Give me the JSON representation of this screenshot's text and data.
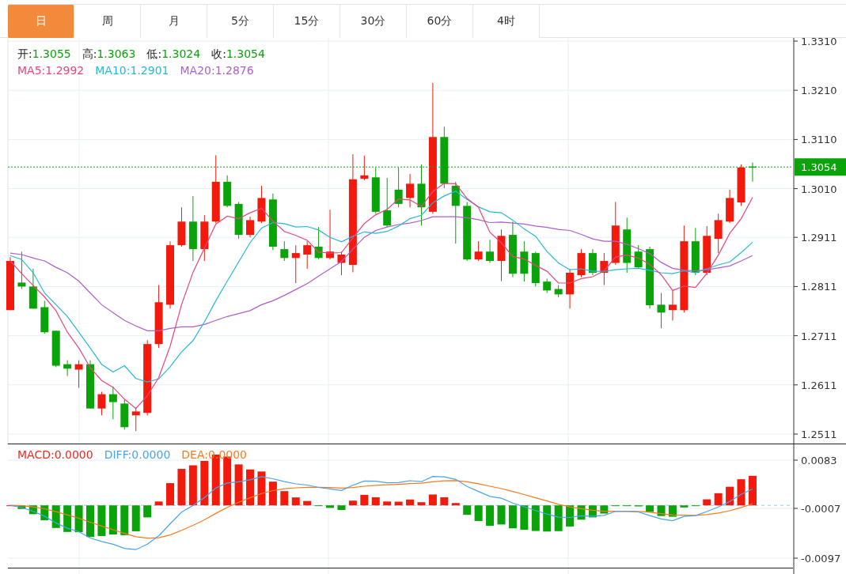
{
  "tabs": [
    {
      "label": "日",
      "selected": true
    },
    {
      "label": "周",
      "selected": false
    },
    {
      "label": "月",
      "selected": false
    },
    {
      "label": "5分",
      "selected": false
    },
    {
      "label": "15分",
      "selected": false
    },
    {
      "label": "30分",
      "selected": false
    },
    {
      "label": "60分",
      "selected": false
    },
    {
      "label": "4时",
      "selected": false
    }
  ],
  "price_chart": {
    "legend_ohlc": [
      {
        "label": "开:",
        "value": "1.3055"
      },
      {
        "label": "高:",
        "value": "1.3063"
      },
      {
        "label": "低:",
        "value": "1.3024"
      },
      {
        "label": "收:",
        "value": "1.3054"
      }
    ],
    "legend_ma": [
      {
        "label": "MA5:",
        "value": "1.2992",
        "color": "#e8467c"
      },
      {
        "label": "MA10:",
        "value": "1.2901",
        "color": "#27b8d8"
      },
      {
        "label": "MA20:",
        "value": "1.2876",
        "color": "#b05ec8"
      }
    ],
    "chart_data": {
      "type": "candlestick",
      "grid": true,
      "categories": [
        null,
        null,
        null,
        null,
        null,
        null,
        null,
        null,
        null,
        null,
        null,
        null,
        null,
        null,
        null,
        null,
        null,
        null,
        null,
        null,
        null,
        null,
        null,
        null,
        null,
        null,
        null,
        null,
        null,
        null,
        null,
        null,
        null,
        null,
        null,
        null,
        null,
        null,
        null,
        null,
        null,
        null,
        null,
        null,
        null,
        null,
        null,
        null,
        null,
        null,
        null,
        null,
        null,
        null,
        null,
        null,
        null,
        null,
        null,
        null,
        null,
        null,
        null,
        null,
        null,
        null
      ],
      "ylim": [
        1.2511,
        1.331
      ],
      "yticks": [
        {
          "value": 1.331,
          "label": "1.3310"
        },
        {
          "value": 1.321,
          "label": "1.3210"
        },
        {
          "value": 1.311,
          "label": "1.3110"
        },
        {
          "value": 1.301,
          "label": "1.3010"
        },
        {
          "value": 1.2911,
          "label": "1.2911"
        },
        {
          "value": 1.2811,
          "label": "1.2811"
        },
        {
          "value": 1.2711,
          "label": "1.2711"
        },
        {
          "value": 1.2611,
          "label": "1.2611"
        },
        {
          "value": 1.2511,
          "label": "1.2511"
        }
      ],
      "ref_lines": [
        {
          "axis": "y",
          "value": 1.3054,
          "label": "1.3054"
        }
      ],
      "series": [
        {
          "type": "line",
          "color": "#b05ec8",
          "values": [
            1.2879,
            1.2876,
            1.2869,
            1.2863,
            1.285,
            1.2839,
            1.2822,
            1.2798,
            1.2774,
            1.2758,
            1.2742,
            1.2731,
            1.2721,
            1.2721,
            1.2726,
            1.2729,
            1.2729,
            1.2734,
            1.2742,
            1.275,
            1.2756,
            1.2762,
            1.2774,
            1.2782,
            1.2793,
            1.2805,
            1.2817,
            1.2832,
            1.2847,
            1.2862,
            1.2887,
            1.2911,
            1.2925,
            1.2932,
            1.2937,
            1.294,
            1.2945,
            1.2953,
            1.2953,
            1.2953,
            1.2951,
            1.2947,
            1.2941,
            1.2942,
            1.294,
            1.2938,
            1.2934,
            1.2931,
            1.2927,
            1.2925,
            1.2917,
            1.2908,
            1.2903,
            1.2903,
            1.2897,
            1.2888,
            1.2878,
            1.286,
            1.2848,
            1.2844,
            1.2843,
            1.2845,
            1.2849,
            1.2853,
            1.2863,
            1.2874
          ]
        },
        {
          "type": "line",
          "color": "#27b8d8",
          "values": [
            1.2874,
            1.2866,
            1.2839,
            1.2798,
            1.2774,
            1.275,
            1.2718,
            1.2686,
            1.2653,
            1.2637,
            1.265,
            1.2624,
            1.2617,
            1.2623,
            1.2648,
            1.2678,
            1.2701,
            1.2739,
            1.2782,
            1.2822,
            1.2861,
            1.29,
            1.293,
            1.2941,
            1.2939,
            1.2932,
            1.2933,
            1.2926,
            1.2911,
            1.2902,
            1.2913,
            1.2922,
            1.2919,
            1.2923,
            1.2934,
            1.2949,
            1.2956,
            1.2981,
            1.2995,
            1.3005,
            1.2988,
            1.2973,
            1.2963,
            1.2961,
            1.2946,
            1.2928,
            1.2913,
            1.2882,
            1.2859,
            1.2845,
            1.2847,
            1.2842,
            1.2842,
            1.2845,
            1.2847,
            1.2848,
            1.2844,
            1.2839,
            1.2837,
            1.2843,
            1.2839,
            1.2847,
            1.2855,
            1.2861,
            1.288,
            1.2901
          ]
        },
        {
          "type": "line",
          "color": "#e8467c",
          "values": [
            1.2863,
            1.2837,
            1.2813,
            1.279,
            1.2762,
            1.2718,
            1.2686,
            1.2646,
            1.262,
            1.2606,
            1.2582,
            1.2563,
            1.2589,
            1.2626,
            1.269,
            1.2774,
            1.284,
            1.2889,
            1.2938,
            1.2954,
            1.2949,
            1.2961,
            1.297,
            1.2944,
            1.2923,
            1.2915,
            1.2905,
            1.2881,
            1.2879,
            1.288,
            1.291,
            1.2939,
            1.2957,
            1.2968,
            1.2989,
            1.2987,
            1.2974,
            1.3004,
            1.3021,
            1.302,
            1.299,
            1.2972,
            1.2921,
            1.29,
            1.2872,
            1.2867,
            1.2854,
            1.2842,
            1.2818,
            1.2818,
            1.2827,
            1.2831,
            1.2843,
            1.2871,
            1.2875,
            1.2869,
            1.2856,
            1.2835,
            1.2803,
            1.2812,
            1.2809,
            1.2838,
            1.2875,
            1.2919,
            1.2949,
            1.2992
          ]
        }
      ],
      "ohlc": [
        [
          1.2763,
          1.2871,
          1.2763,
          1.2863
        ],
        [
          1.2819,
          1.2882,
          1.2806,
          1.2811
        ],
        [
          1.2811,
          1.2847,
          1.2766,
          1.2766
        ],
        [
          1.2769,
          1.2782,
          1.2715,
          1.2718
        ],
        [
          1.2721,
          1.2721,
          1.2647,
          1.265
        ],
        [
          1.2653,
          1.2661,
          1.2629,
          1.2644
        ],
        [
          1.2642,
          1.2661,
          1.2605,
          1.2653
        ],
        [
          1.2653,
          1.2661,
          1.2563,
          1.2563
        ],
        [
          1.2563,
          1.2597,
          1.2549,
          1.2592
        ],
        [
          1.2592,
          1.2608,
          1.2541,
          1.2576
        ],
        [
          1.2573,
          1.2581,
          1.252,
          1.2525
        ],
        [
          1.2549,
          1.2565,
          1.2517,
          1.2557
        ],
        [
          1.2554,
          1.2702,
          1.2549,
          1.2694
        ],
        [
          1.2694,
          1.2814,
          1.2686,
          1.2779
        ],
        [
          1.2774,
          1.2903,
          1.2766,
          1.2895
        ],
        [
          1.2895,
          1.2972,
          1.2892,
          1.2943
        ],
        [
          1.2943,
          1.2995,
          1.2863,
          1.2887
        ],
        [
          1.2887,
          1.2956,
          1.2863,
          1.2943
        ],
        [
          1.2943,
          1.3078,
          1.294,
          1.3024
        ],
        [
          1.3024,
          1.3037,
          1.2972,
          1.2975
        ],
        [
          1.2979,
          1.2983,
          1.2908,
          1.2916
        ],
        [
          1.2916,
          1.2953,
          1.2911,
          1.2946
        ],
        [
          1.2943,
          1.3016,
          1.294,
          1.2991
        ],
        [
          1.2988,
          1.3,
          1.2885,
          1.2892
        ],
        [
          1.2887,
          1.2903,
          1.2863,
          1.2869
        ],
        [
          1.2869,
          1.2895,
          1.2818,
          1.2879
        ],
        [
          1.2876,
          1.2903,
          1.2847,
          1.2895
        ],
        [
          1.2892,
          1.2932,
          1.2866,
          1.2869
        ],
        [
          1.2869,
          1.2967,
          1.2866,
          1.2882
        ],
        [
          1.2859,
          1.2882,
          1.2834,
          1.2876
        ],
        [
          1.2855,
          1.308,
          1.284,
          1.3029
        ],
        [
          1.303,
          1.3077,
          1.3027,
          1.3037
        ],
        [
          1.3033,
          1.3053,
          1.2959,
          1.2963
        ],
        [
          1.2966,
          1.3032,
          1.2932,
          1.2935
        ],
        [
          1.3008,
          1.3053,
          1.2972,
          1.2979
        ],
        [
          1.2991,
          1.304,
          1.2972,
          1.302
        ],
        [
          1.302,
          1.3059,
          1.2935,
          1.2972
        ],
        [
          1.2963,
          1.3225,
          1.2959,
          1.3115
        ],
        [
          1.3115,
          1.3136,
          1.3011,
          1.302
        ],
        [
          1.3016,
          1.3024,
          1.2898,
          1.2975
        ],
        [
          1.2975,
          1.2983,
          1.2863,
          1.2866
        ],
        [
          1.2866,
          1.2903,
          1.2863,
          1.2882
        ],
        [
          1.2882,
          1.2906,
          1.2859,
          1.2863
        ],
        [
          1.2863,
          1.2927,
          1.2822,
          1.2914
        ],
        [
          1.2916,
          1.2943,
          1.283,
          1.2837
        ],
        [
          1.2882,
          1.2903,
          1.2821,
          1.2837
        ],
        [
          1.2879,
          1.2882,
          1.2811,
          1.2818
        ],
        [
          1.2821,
          1.2827,
          1.2798,
          1.2803
        ],
        [
          1.2806,
          1.2814,
          1.2789,
          1.2795
        ],
        [
          1.2795,
          1.2847,
          1.2766,
          1.2839
        ],
        [
          1.2834,
          1.2887,
          1.283,
          1.2879
        ],
        [
          1.2879,
          1.2887,
          1.2834,
          1.2839
        ],
        [
          1.2839,
          1.2879,
          1.2814,
          1.2863
        ],
        [
          1.2859,
          1.2983,
          1.2855,
          1.2935
        ],
        [
          1.2927,
          1.2951,
          1.2839,
          1.2859
        ],
        [
          1.2882,
          1.2895,
          1.2847,
          1.285
        ],
        [
          1.2887,
          1.2892,
          1.2766,
          1.2773
        ],
        [
          1.2774,
          1.2798,
          1.2726,
          1.2758
        ],
        [
          1.2763,
          1.2802,
          1.2742,
          1.2774
        ],
        [
          1.2763,
          1.2935,
          1.2758,
          1.2903
        ],
        [
          1.2903,
          1.293,
          1.2834,
          1.2839
        ],
        [
          1.2839,
          1.2934,
          1.2834,
          1.2914
        ],
        [
          1.2908,
          1.2959,
          1.2879,
          1.2946
        ],
        [
          1.2943,
          1.3008,
          1.294,
          1.2991
        ],
        [
          1.2982,
          1.3059,
          1.2975,
          1.3053
        ],
        [
          1.3055,
          1.3063,
          1.3024,
          1.3054
        ]
      ]
    }
  },
  "macd_chart": {
    "legend": [
      {
        "label": "MACD:",
        "value": "0.0000",
        "color": "#f0281e"
      },
      {
        "label": "DIFF:",
        "value": "0.0000",
        "color": "#4aa3e8"
      },
      {
        "label": "DEA:",
        "value": "0.0000",
        "color": "#f77b1e"
      }
    ],
    "axis_labels": [
      "0.0083",
      "-0.0007",
      "-0.0097"
    ]
  }
}
